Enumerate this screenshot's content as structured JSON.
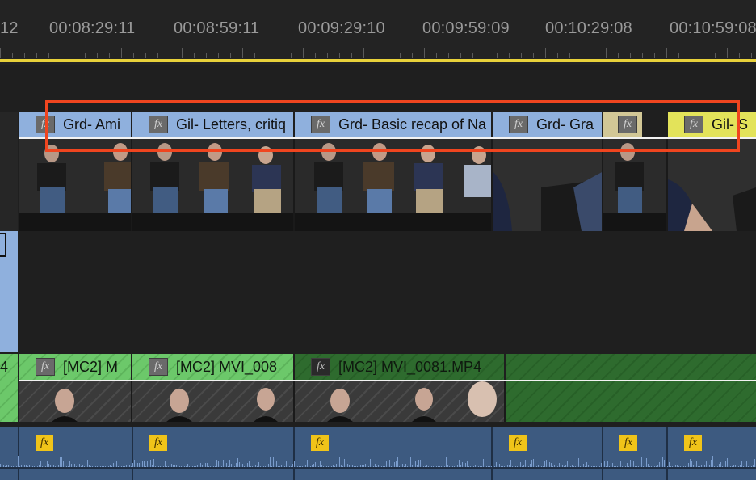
{
  "ruler": {
    "timecodes": [
      "12",
      "00:08:29:11",
      "00:08:59:11",
      "00:09:29:10",
      "00:09:59:09",
      "00:10:29:08",
      "00:10:59:08"
    ]
  },
  "colors": {
    "playhead_bar": "#e8d13a",
    "clip_blue": "#8fb0dd",
    "clip_yellow": "#e3e35a",
    "clip_tan": "#d2c796",
    "clip_green": "#6cc86a",
    "audio_blue": "#3d5a80",
    "highlight": "#f0451f"
  },
  "video_clips": [
    {
      "label": "Grd- Ami",
      "fx": "fx"
    },
    {
      "label": "Gil- Letters, critiq",
      "fx": "fx"
    },
    {
      "label": "Grd- Basic recap of Na",
      "fx": "fx"
    },
    {
      "label": "Grd- Gra",
      "fx": "fx"
    },
    {
      "label": "",
      "fx": "fx"
    },
    {
      "label": "Gil- S",
      "fx": "fx"
    }
  ],
  "green_clips": [
    {
      "label": "[MC2] M",
      "fx": "fx"
    },
    {
      "label": "[MC2] MVI_008",
      "fx": "fx"
    },
    {
      "label": "[MC2] MVI_0081.MP4",
      "fx": "fx"
    }
  ],
  "left_edge_label": "4",
  "audio_fx": [
    "fx",
    "fx",
    "fx",
    "fx",
    "fx",
    "fx"
  ]
}
